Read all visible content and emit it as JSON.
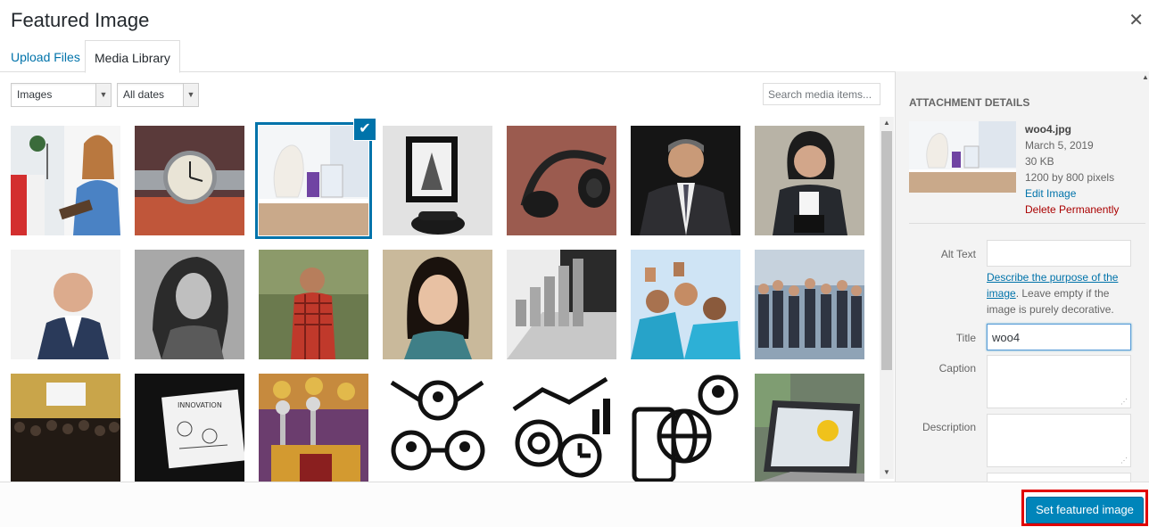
{
  "modal": {
    "title": "Featured Image"
  },
  "tabs": [
    {
      "label": "Upload Files",
      "active": false
    },
    {
      "label": "Media Library",
      "active": true
    }
  ],
  "filters": {
    "type": "Images",
    "date": "All dates",
    "search_placeholder": "Search media items..."
  },
  "grid_items": [
    "woman-reading",
    "wristwatch",
    "vase-woo4",
    "framed-photo-telephone",
    "headphones",
    "businessman",
    "businesswoman-tablet",
    "smiling-man",
    "woman-portrait",
    "man-checked-shirt",
    "smiling-girl",
    "coins-laptop",
    "thumbs-up-group",
    "crowd-hall",
    "conference-audience",
    "innovation-sketch",
    "trophies",
    "network-people-icon",
    "gears-chart-icon",
    "devices-globe-icon",
    "laptop-screen"
  ],
  "selected_index": 2,
  "details": {
    "heading": "Attachment Details",
    "filename": "woo4.jpg",
    "date": "March 5, 2019",
    "size": "30 KB",
    "dimensions": "1200 by 800 pixels",
    "edit_label": "Edit Image",
    "delete_label": "Delete Permanently"
  },
  "fields": {
    "alt_label": "Alt Text",
    "alt_value": "",
    "alt_help_link": "Describe the purpose of the image",
    "alt_help_text": ". Leave empty if the image is purely decorative.",
    "title_label": "Title",
    "title_value": "woo4",
    "caption_label": "Caption",
    "caption_value": "",
    "description_label": "Description",
    "description_value": ""
  },
  "footer": {
    "primary_label": "Set featured image"
  },
  "colors": {
    "accent": "#0073aa",
    "primary_button": "#0085ba",
    "danger": "#aa0000",
    "highlight": "#e00000"
  }
}
